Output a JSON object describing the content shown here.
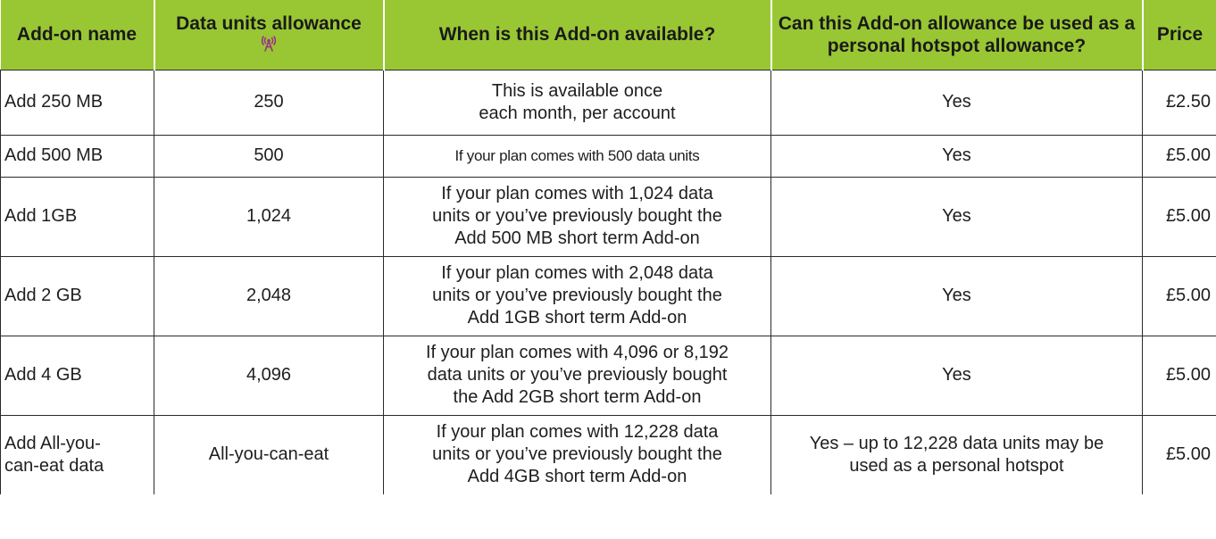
{
  "table": {
    "headers": {
      "name": "Add-on name",
      "units": "Data units allowance",
      "when": "When is this Add-on available?",
      "hotspot": "Can this Add-on allowance be used as a personal hotspot allowance?",
      "price": "Price"
    },
    "units_icon": "antenna-icon",
    "header_color": "#99c734",
    "rows": [
      {
        "name": "Add 250 MB",
        "units": "250",
        "when": "This is available once\neach month, per account",
        "hotspot": "Yes",
        "price": "£2.50"
      },
      {
        "name": "Add 500 MB",
        "units": "500",
        "when": "If your plan comes with 500 data units",
        "hotspot": "Yes",
        "price": "£5.00"
      },
      {
        "name": "Add 1GB",
        "units": "1,024",
        "when": "If your plan comes with 1,024 data\nunits or you’ve previously bought the\nAdd 500 MB short term Add-on",
        "hotspot": "Yes",
        "price": "£5.00"
      },
      {
        "name": "Add 2 GB",
        "units": "2,048",
        "when": "If your plan comes with 2,048 data\nunits or you’ve previously bought the\nAdd 1GB short term Add-on",
        "hotspot": "Yes",
        "price": "£5.00"
      },
      {
        "name": "Add 4 GB",
        "units": "4,096",
        "when": "If your plan comes with 4,096 or 8,192\ndata units or you’ve previously bought\nthe Add 2GB short term Add-on",
        "hotspot": "Yes",
        "price": "£5.00"
      },
      {
        "name": "Add All-you-\ncan-eat data",
        "units": "All-you-can-eat",
        "when": "If your plan comes with 12,228 data\nunits or you’ve previously bought the\nAdd 4GB short term Add-on",
        "hotspot": "Yes – up to 12,228 data units may be\nused as a personal hotspot",
        "price": "£5.00"
      }
    ]
  }
}
